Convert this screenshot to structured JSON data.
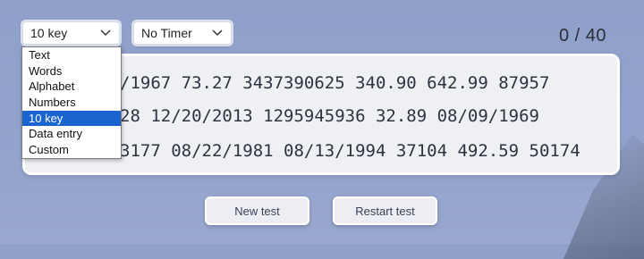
{
  "controls": {
    "mode": {
      "selected": "10 key",
      "options": [
        "Text",
        "Words",
        "Alphabet",
        "Numbers",
        "10 key",
        "Data entry",
        "Custom"
      ]
    },
    "timer": {
      "selected": "No Timer"
    }
  },
  "counter": "0 / 40",
  "test_text": {
    "lines": [
      "/1967 73.27 3437390625 340.90 642.99 87957",
      "28 12/20/2013 1295945936 32.89 08/09/1969",
      "3177 08/22/1981 08/13/1994 37104 492.59 50174"
    ]
  },
  "buttons": {
    "new_test": "New test",
    "restart_test": "Restart test"
  },
  "colors": {
    "selected_option": "#1a64d0",
    "background": "#94a3cd"
  }
}
